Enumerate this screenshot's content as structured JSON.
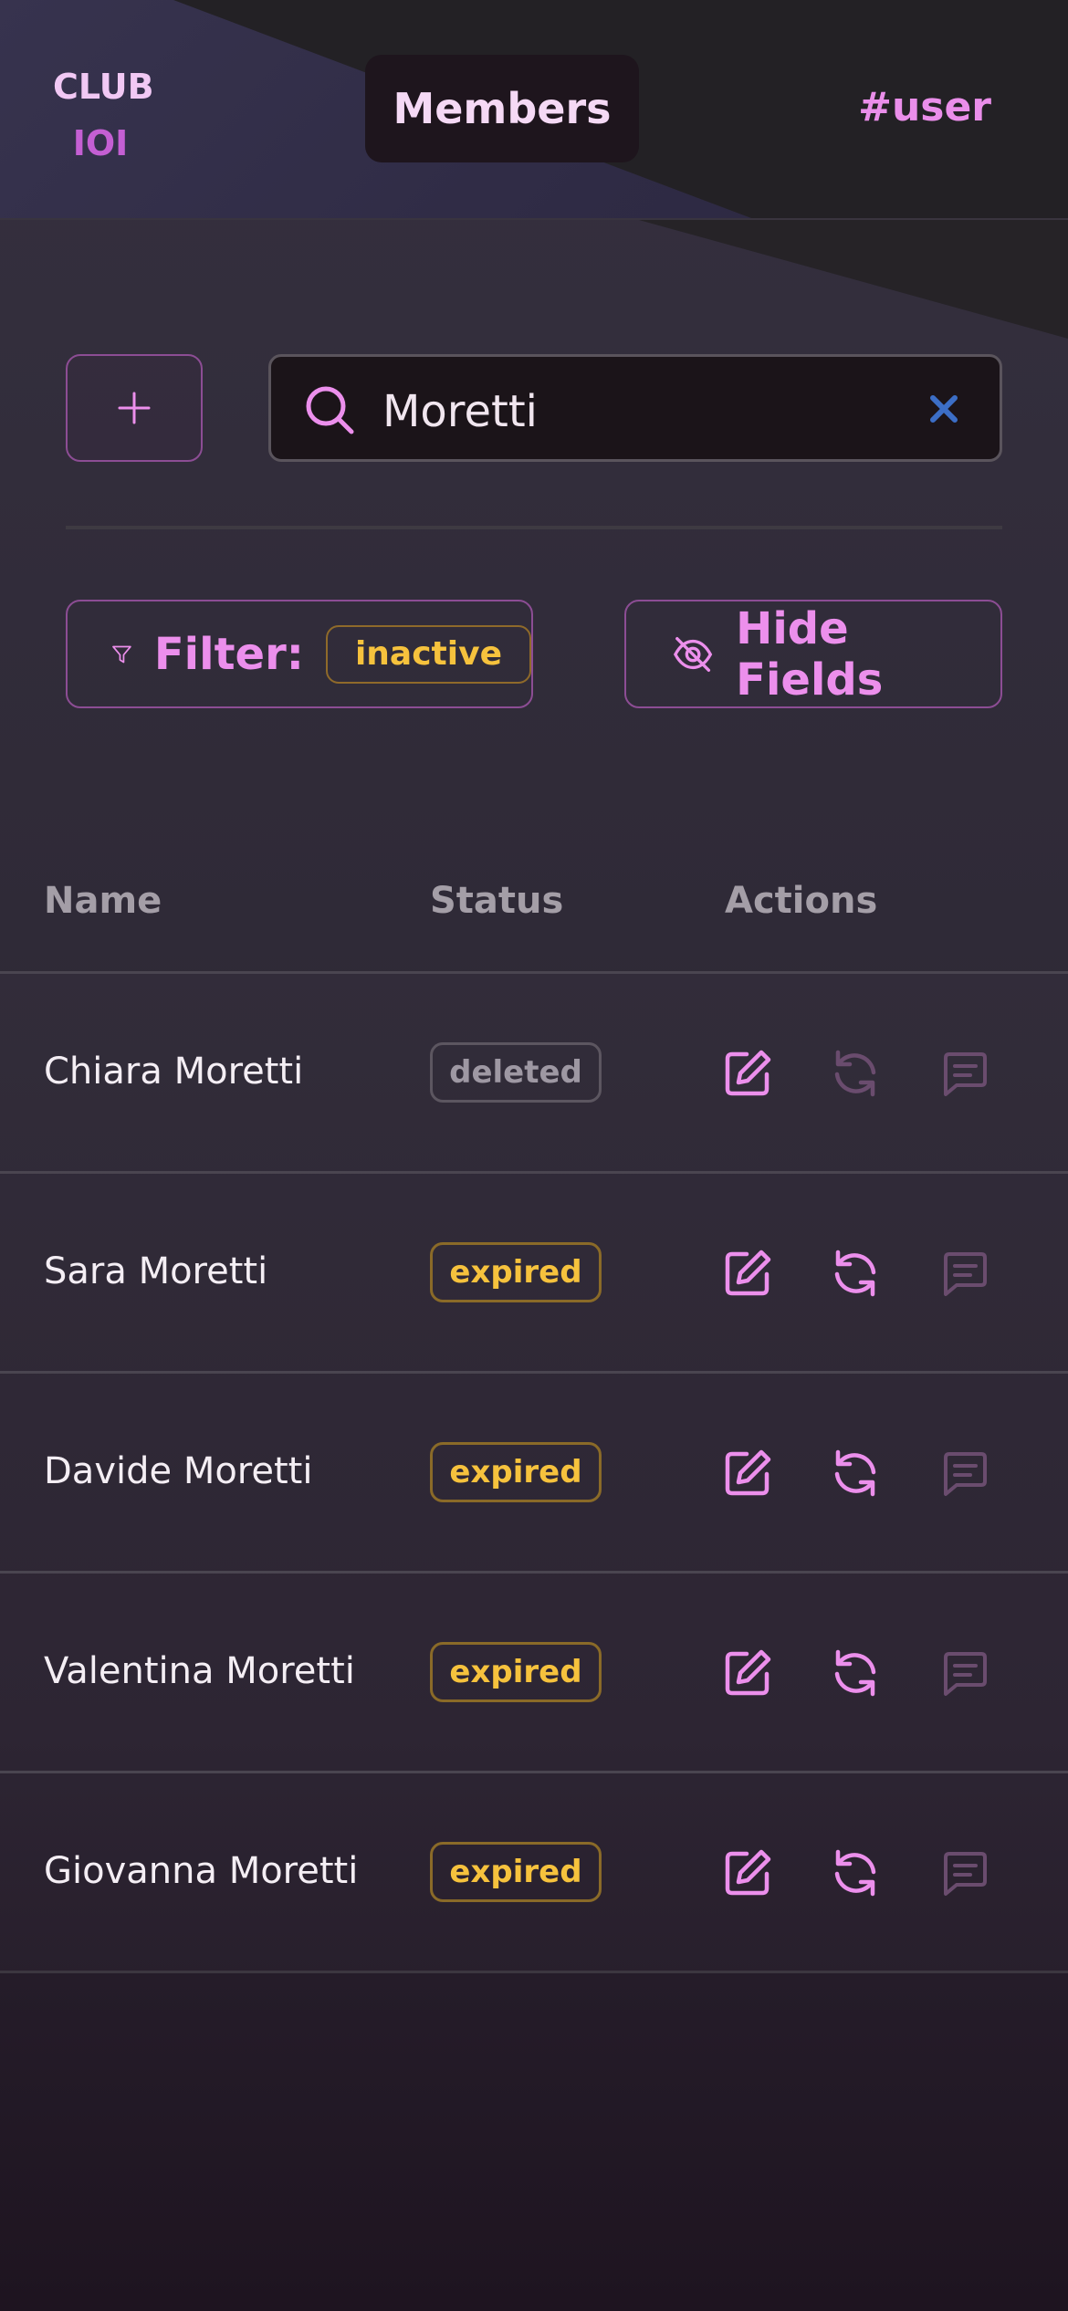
{
  "header": {
    "logo_line1": "CLUB",
    "logo_line2": "IOI",
    "active_tab": "Members",
    "user_tag": "#user"
  },
  "toolbar": {
    "add_icon": "plus-icon",
    "search": {
      "value": "Moretti",
      "icon": "search-icon",
      "clear_icon": "close-icon"
    },
    "filter": {
      "label": "Filter:",
      "chip": "inactive",
      "icon": "filter-icon"
    },
    "hide_fields": {
      "label": "Hide Fields",
      "icon": "eye-off-icon"
    }
  },
  "table": {
    "columns": [
      "Name",
      "Status",
      "Actions"
    ],
    "rows": [
      {
        "name": "Chiara Moretti",
        "status": "deleted",
        "sync_enabled": false
      },
      {
        "name": "Sara Moretti",
        "status": "expired",
        "sync_enabled": true
      },
      {
        "name": "Davide Moretti",
        "status": "expired",
        "sync_enabled": true
      },
      {
        "name": "Valentina Moretti",
        "status": "expired",
        "sync_enabled": true
      },
      {
        "name": "Giovanna Moretti",
        "status": "expired",
        "sync_enabled": true
      }
    ],
    "action_icons": [
      "edit-icon",
      "refresh-icon",
      "message-icon"
    ]
  },
  "colors": {
    "accent": "#ec8fec",
    "accent_dim": "#6a4c6e",
    "warning": "#f6c23d",
    "clear": "#3c6ec6"
  }
}
